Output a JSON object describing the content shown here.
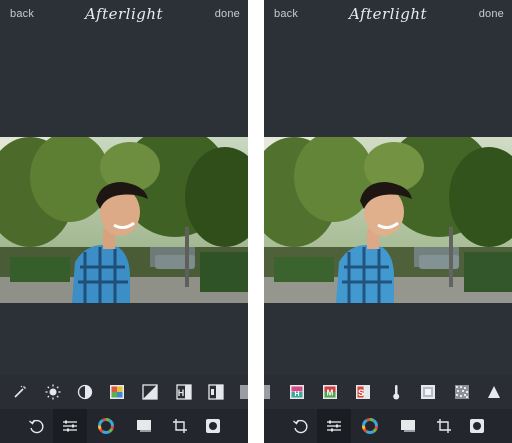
{
  "left_screen": {
    "header": {
      "back_label": "back",
      "title": "Afterlight",
      "done_label": "done"
    },
    "tools_row": [
      "magic-wand-icon",
      "brightness-icon",
      "contrast-icon",
      "saturation-icon",
      "exposure-icon",
      "highlights-icon",
      "shadows-icon",
      "split-icon"
    ],
    "bottom_tabs": [
      "undo-icon",
      "adjust-icon",
      "filters-icon",
      "textures-icon",
      "crop-icon",
      "frames-icon"
    ],
    "active_tab": "adjust-icon"
  },
  "right_screen": {
    "header": {
      "back_label": "back",
      "title": "Afterlight",
      "done_label": "done"
    },
    "tools_row": [
      "split-icon",
      "color-balance-icon",
      "mix-icon",
      "s-curve-icon",
      "temperature-icon",
      "grain-icon",
      "noise-icon",
      "sharpen-icon"
    ],
    "bottom_tabs": [
      "undo-icon",
      "adjust-icon",
      "filters-icon",
      "textures-icon",
      "crop-icon",
      "frames-icon"
    ],
    "active_tab": "adjust-icon"
  },
  "tool_letters": {
    "h": "H",
    "m": "M",
    "s": "S"
  },
  "colors": {
    "panel": "#2c3037",
    "tools_bg": "#2a2e34",
    "bottom_bg": "#23262c",
    "icon": "#e6e8eb",
    "active_bg": "#1a1d22"
  }
}
